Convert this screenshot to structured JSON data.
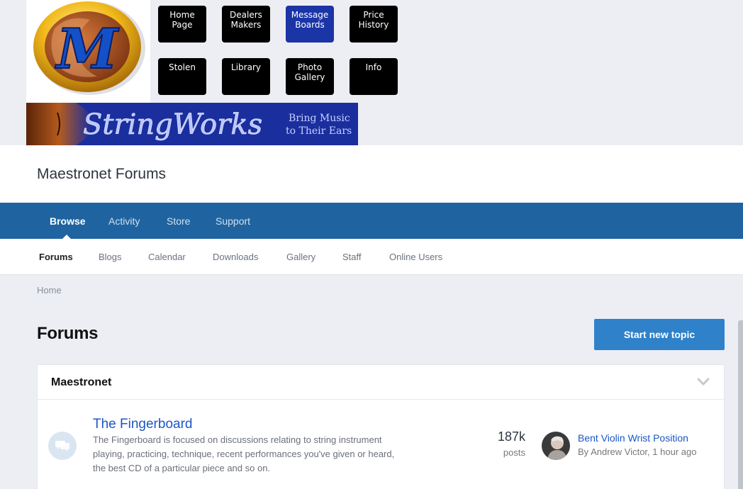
{
  "top_nav": {
    "buttons": [
      {
        "line1": "Home",
        "line2": "Page"
      },
      {
        "line1": "Dealers",
        "line2": "Makers"
      },
      {
        "line1": "Message",
        "line2": "Boards"
      },
      {
        "line1": "Price",
        "line2": "History"
      },
      {
        "line1": "Stolen",
        "line2": ""
      },
      {
        "line1": "Library",
        "line2": ""
      },
      {
        "line1": "Photo",
        "line2": "Gallery"
      },
      {
        "line1": "Info",
        "line2": ""
      }
    ],
    "active_index": 2,
    "active_color": "#1b34a6"
  },
  "logo": {
    "letter": "M",
    "icon": "maestronet-logo"
  },
  "ad_banner": {
    "brand": "StringWorks",
    "tagline_line1": "Bring Music",
    "tagline_line2": "to Their Ears"
  },
  "site": {
    "title": "Maestronet Forums"
  },
  "primary_nav": {
    "items": [
      "Browse",
      "Activity",
      "Store",
      "Support"
    ],
    "active": "Browse",
    "color": "#1f64a0"
  },
  "secondary_nav": {
    "items": [
      "Forums",
      "Blogs",
      "Calendar",
      "Downloads",
      "Gallery",
      "Staff",
      "Online Users"
    ],
    "active": "Forums"
  },
  "breadcrumb": {
    "home": "Home"
  },
  "page": {
    "title": "Forums",
    "start_topic_label": "Start new topic",
    "accent": "#2f81c9"
  },
  "category": {
    "title": "Maestronet",
    "toggle_icon": "chevron-down-icon",
    "forums": [
      {
        "name": "The Fingerboard",
        "icon": "chat-bubbles-icon",
        "description_lines": [
          "The Fingerboard is focused on discussions relating to string instrument",
          "playing, practicing, technique, recent performances you've given or heard,",
          "the best CD of a particular piece and so on."
        ],
        "posts_count": "187k",
        "posts_label": "posts",
        "last_post": {
          "title": "Bent Violin Wrist Position",
          "by_prefix": "By",
          "author": "Andrew Victor",
          "time": "1 hour ago"
        }
      }
    ]
  }
}
